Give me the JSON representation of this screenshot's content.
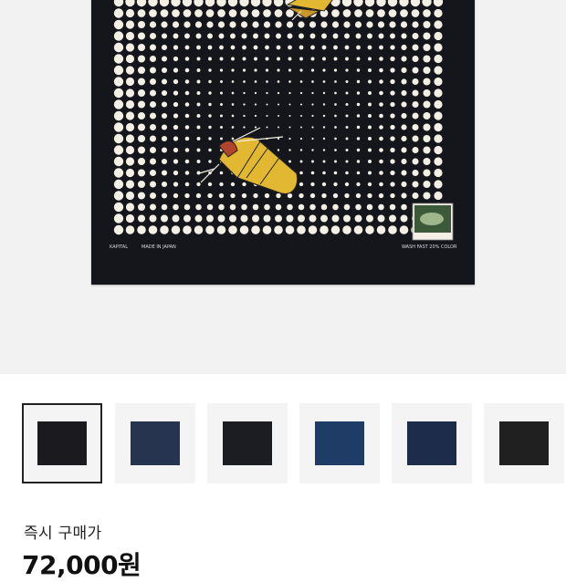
{
  "product_image": {
    "print_left_text": "KAPITAL",
    "print_center_text": "MADE IN JAPAN",
    "print_right_text": "WASH FAST 20% COLOR",
    "colors": {
      "background": "#f2f2f2",
      "bandana": "#14161c",
      "dots": "#f3efe4",
      "butterfly": "#e2b832"
    }
  },
  "thumbnails": [
    {
      "name": "black-polka-butterfly",
      "color": "#1b1b1f",
      "active": true
    },
    {
      "name": "navy-butterfly",
      "color": "#27344f",
      "active": false
    },
    {
      "name": "black-moon-pattern",
      "color": "#1c1d22",
      "active": false
    },
    {
      "name": "blue-moon-pattern",
      "color": "#1f3c66",
      "active": false
    },
    {
      "name": "navy-white-print",
      "color": "#1e2c4c",
      "active": false
    },
    {
      "name": "black-checker",
      "color": "#202020",
      "active": false
    }
  ],
  "price": {
    "label": "즉시 구매가",
    "value": "72,000원"
  }
}
